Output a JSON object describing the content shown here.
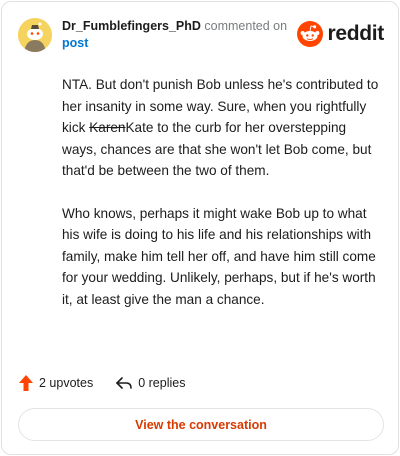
{
  "header": {
    "username": "Dr_Fumblefingers_PhD",
    "action": "commented on",
    "post_link": "post",
    "brand": "reddit"
  },
  "comment": {
    "p1_a": "NTA. But don't punish Bob unless he's contributed to her insanity in some way. Sure, when you rightfully kick ",
    "p1_strike": "Karen",
    "p1_b": "Kate to the curb for her overstepping ways, chances are that she won't let Bob come, but that'd be between the two of them.",
    "p2": "Who knows, perhaps it might wake Bob up to what his wife is doing to his life and his relationships with family, make him tell her off, and have him still come for your wedding. Unlikely, perhaps, but if he's worth it, at least give the man a chance."
  },
  "footer": {
    "upvotes": "2 upvotes",
    "replies": "0 replies"
  },
  "cta": {
    "label": "View the conversation"
  },
  "colors": {
    "accent": "#d93a00",
    "link": "#0079d3",
    "upvote": "#ff4500"
  }
}
